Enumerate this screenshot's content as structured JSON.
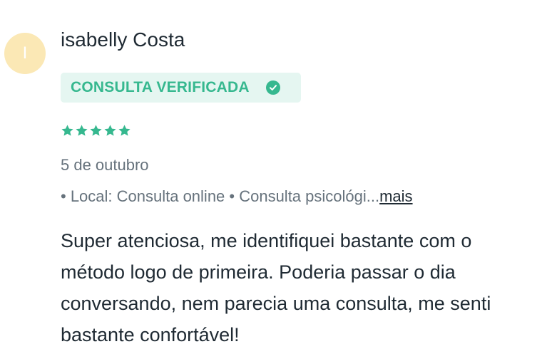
{
  "reviewer": {
    "avatar_initial": "I",
    "name": "isabelly Costa"
  },
  "badge": {
    "label": "CONSULTA VERIFICADA",
    "icon": "check-circle-icon",
    "color": "#36b88f",
    "background": "#e5f6f1"
  },
  "rating": {
    "stars": 5,
    "max": 5,
    "icon": "star-icon"
  },
  "date": "5 de outubro",
  "meta": {
    "items": "• Local: Consulta online • Consulta psicológi...",
    "more_link": "mais"
  },
  "review_text": "Super atenciosa, me identifiquei bastante com o método logo de primeira. Poderia passar o dia conversando, nem parecia uma consulta, me senti bastante confortável!"
}
